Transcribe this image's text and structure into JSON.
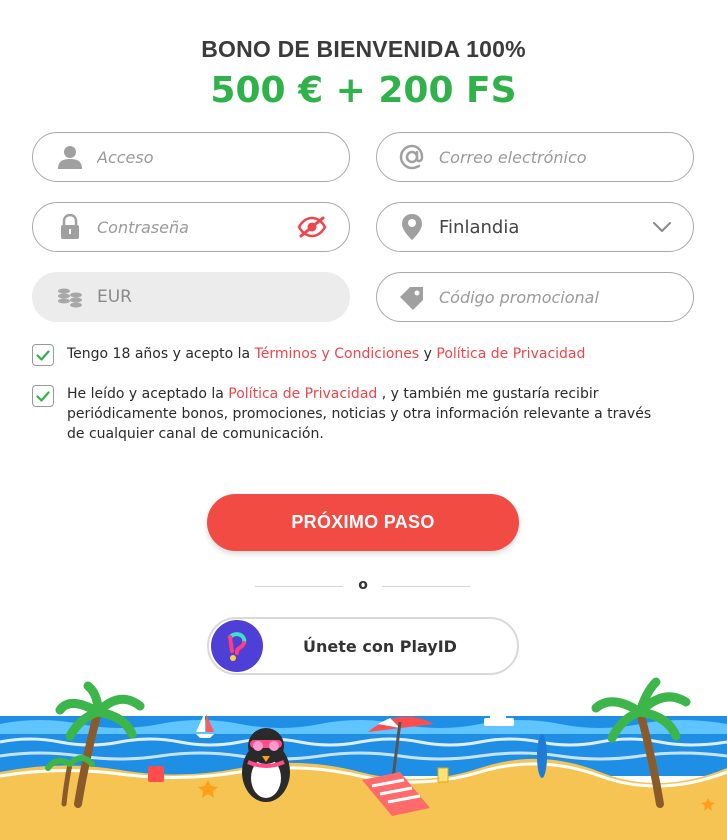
{
  "header": {
    "title": "BONO DE BIENVENIDA 100%",
    "amount": "500 € + 200 FS"
  },
  "form": {
    "login_placeholder": "Acceso",
    "email_placeholder": "Correo electrónico",
    "password_placeholder": "Contraseña",
    "country_value": "Finlandia",
    "currency_value": "EUR",
    "promo_placeholder": "Código promocional"
  },
  "checkboxes": {
    "terms": {
      "checked": true,
      "text_before": "Tengo 18 años y acepto la ",
      "link1": "Términos y Condiciones",
      "text_mid": " y ",
      "link2": "Política de Privacidad"
    },
    "marketing": {
      "checked": true,
      "text_before": "He leído y aceptado la ",
      "link": "Política de Privacidad",
      "text_after": " , y también me gustaría recibir periódicamente bonos, promociones, noticias y otra información relevante a través de cualquier canal de comunicación."
    }
  },
  "actions": {
    "next_label": "PRÓXIMO PASO",
    "or_label": "o",
    "playid_label": "Únete con PlayID"
  },
  "colors": {
    "accent_green": "#2fb24a",
    "accent_red": "#f24b43",
    "link_red": "#f0454a",
    "checkbox_green": "#2fb24a"
  },
  "icons": {
    "login": "user-icon",
    "email": "at-icon",
    "password": "lock-icon",
    "password_toggle": "eye-slash-icon",
    "country": "location-pin-icon",
    "country_dropdown": "chevron-down-icon",
    "currency": "coins-icon",
    "promo": "tag-icon",
    "playid": "playid-logo-icon"
  }
}
